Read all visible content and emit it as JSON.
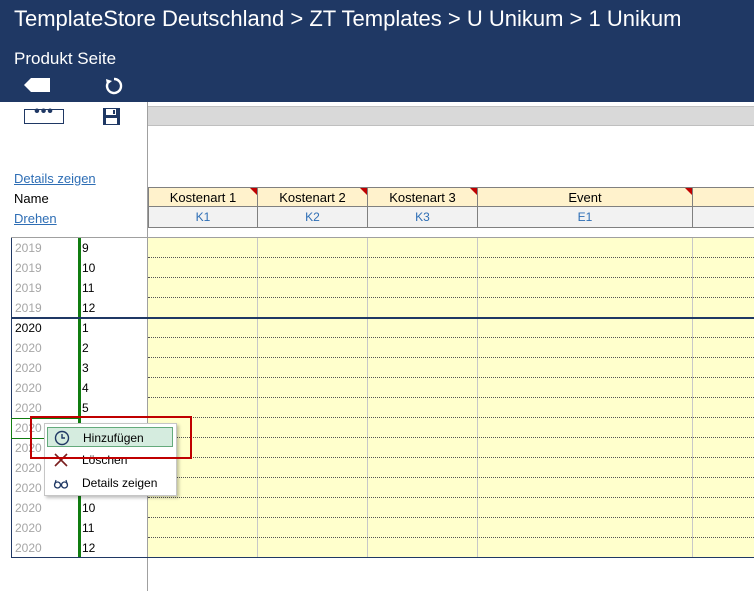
{
  "header": {
    "breadcrumb": "TemplateStore Deutschland > ZT  Templates > U  Unikum > 1  Unikum",
    "page_title": "Produkt Seite"
  },
  "toolbar": {
    "more_label": "•••"
  },
  "sidebar": {
    "details_link": "Details zeigen",
    "name_label": "Name",
    "rotate_link": "Drehen"
  },
  "columns": [
    {
      "label": "Kostenart 1",
      "code": "K1"
    },
    {
      "label": "Kostenart 2",
      "code": "K2"
    },
    {
      "label": "Kostenart 3",
      "code": "K3"
    },
    {
      "label": "Event",
      "code": "E1"
    },
    {
      "label": "",
      "code": ""
    }
  ],
  "rows": [
    {
      "year": "2019",
      "month": "9"
    },
    {
      "year": "2019",
      "month": "10"
    },
    {
      "year": "2019",
      "month": "11"
    },
    {
      "year": "2019",
      "month": "12"
    },
    {
      "year": "2020",
      "month": "1"
    },
    {
      "year": "2020",
      "month": "2"
    },
    {
      "year": "2020",
      "month": "3"
    },
    {
      "year": "2020",
      "month": "4"
    },
    {
      "year": "2020",
      "month": "5"
    },
    {
      "year": "2020",
      "month": ""
    },
    {
      "year": "2020",
      "month": ""
    },
    {
      "year": "2020",
      "month": ""
    },
    {
      "year": "2020",
      "month": ""
    },
    {
      "year": "2020",
      "month": "10"
    },
    {
      "year": "2020",
      "month": "11"
    },
    {
      "year": "2020",
      "month": "12"
    }
  ],
  "context_menu": {
    "items": [
      {
        "label": "Hinzufügen",
        "icon": "clock-icon"
      },
      {
        "label": "Löschen",
        "icon": "x-icon"
      },
      {
        "label": "Details zeigen",
        "icon": "glasses-icon"
      }
    ]
  },
  "colors": {
    "header_bg": "#1f3864",
    "cell_yellow": "#ffffcc",
    "header_yellow": "#fff2cc",
    "link_blue": "#2e6eb5",
    "green_line": "#107c10",
    "highlight_red": "#c00000"
  }
}
